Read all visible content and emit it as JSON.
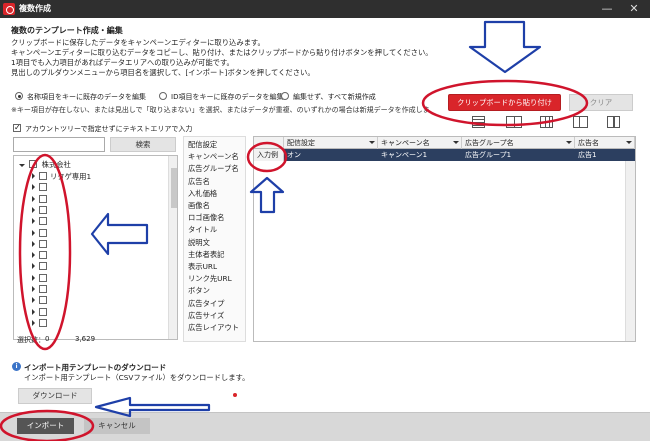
{
  "window": {
    "title": "複数作成",
    "min_glyph": "—",
    "close_glyph": "✕"
  },
  "header": {
    "title": "複数のテンプレート作成・編集",
    "desc": [
      "クリップボードに保存したデータをキャンペーンエディターに取り込みます。",
      "キャンペーンエディターに取り込むデータをコピーし、貼り付け、またはクリップボードから貼り付けボタンを押してください。",
      "1項目でも入力項目があればデータエリアへの取り込みが可能です。",
      "見出しのプルダウンメニューから項目名を選択して、[インポート]ボタンを押してください。"
    ]
  },
  "options": {
    "radio1": "名称項目をキーに既存のデータを編集",
    "radio2": "ID項目をキーに既存のデータを編集",
    "radio3": "編集せず、すべて新規作成",
    "note": "※キー項目が存在しない、または見出しで「取り込まない」を選択、またはデータが重複、のいずれかの場合は新規データを作成しま"
  },
  "buttons": {
    "paste": "クリップボードから貼り付け",
    "clear": "クリア",
    "search": "検索",
    "download": "ダウンロード",
    "import": "インポート",
    "cancel": "キャンセル"
  },
  "account_check": "アカウントツリーで指定せずにテキストエリアで入力",
  "tree": {
    "root": "株式会社",
    "items": [
      "リタゲ専用1",
      "",
      "",
      "",
      "",
      "",
      "",
      "",
      "",
      "",
      "",
      "",
      "",
      ""
    ],
    "count_label": "選択数：",
    "count_a": "0",
    "count_b": "3,629"
  },
  "fields": [
    "配信設定",
    "キャンペーン名",
    "広告グループ名",
    "広告名",
    "入札価格",
    "画像名",
    "ロゴ画像名",
    "タイトル",
    "説明文",
    "主体者表記",
    "表示URL",
    "リンク先URL",
    "ボタン",
    "広告タイプ",
    "広告サイズ",
    "広告レイアウト"
  ],
  "grid": {
    "columns": [
      "配信設定",
      "キャンペーン名",
      "広告グループ名",
      "広告名"
    ],
    "row_label": "入力例",
    "row": [
      "オン",
      "キャンペーン1",
      "広告グループ1",
      "広告1"
    ]
  },
  "template": {
    "title": "インポート用テンプレートのダウンロード",
    "desc": "インポート用テンプレート（CSVファイル）をダウンロードします。"
  },
  "colors": {
    "accent_red": "#d9252a",
    "annotation_red": "#d0142c",
    "annotation_blue": "#1e3fa8",
    "selection": "#2c3f60"
  }
}
